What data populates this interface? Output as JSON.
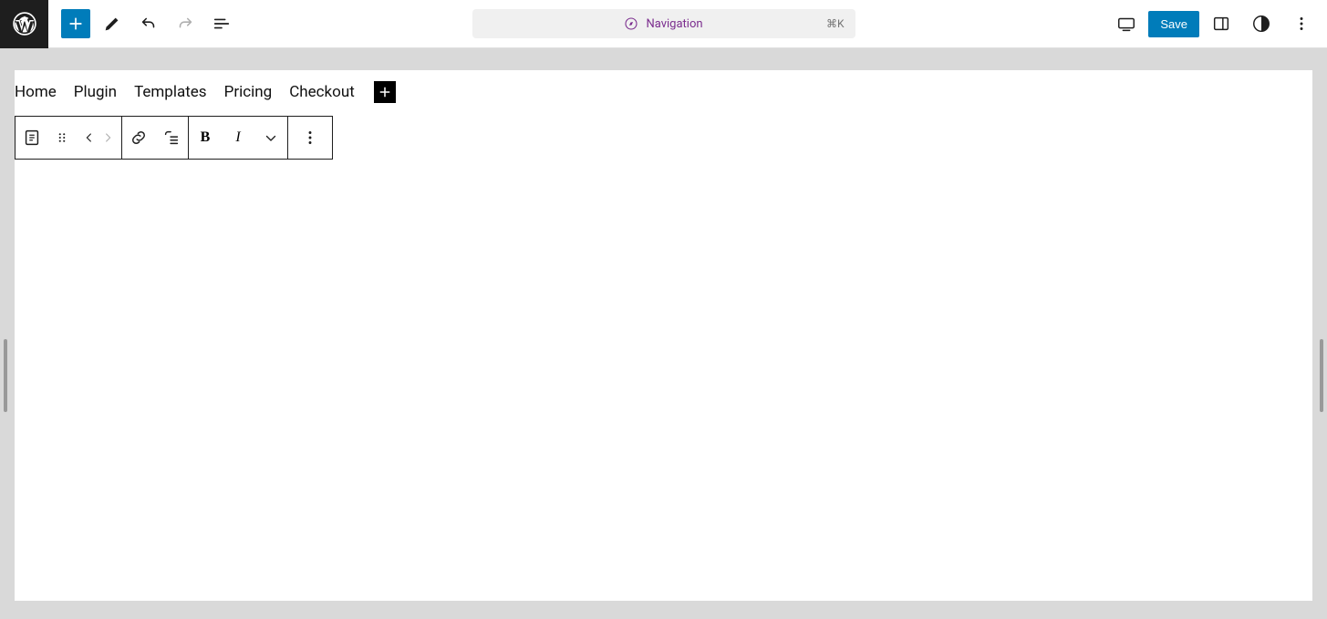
{
  "topbar": {
    "center": {
      "label": "Navigation",
      "shortcut": "⌘K"
    },
    "save_label": "Save"
  },
  "nav_items": [
    "Home",
    "Plugin",
    "Templates",
    "Pricing",
    "Checkout"
  ],
  "toolbar": {
    "bold_glyph": "B",
    "italic_glyph": "I"
  }
}
